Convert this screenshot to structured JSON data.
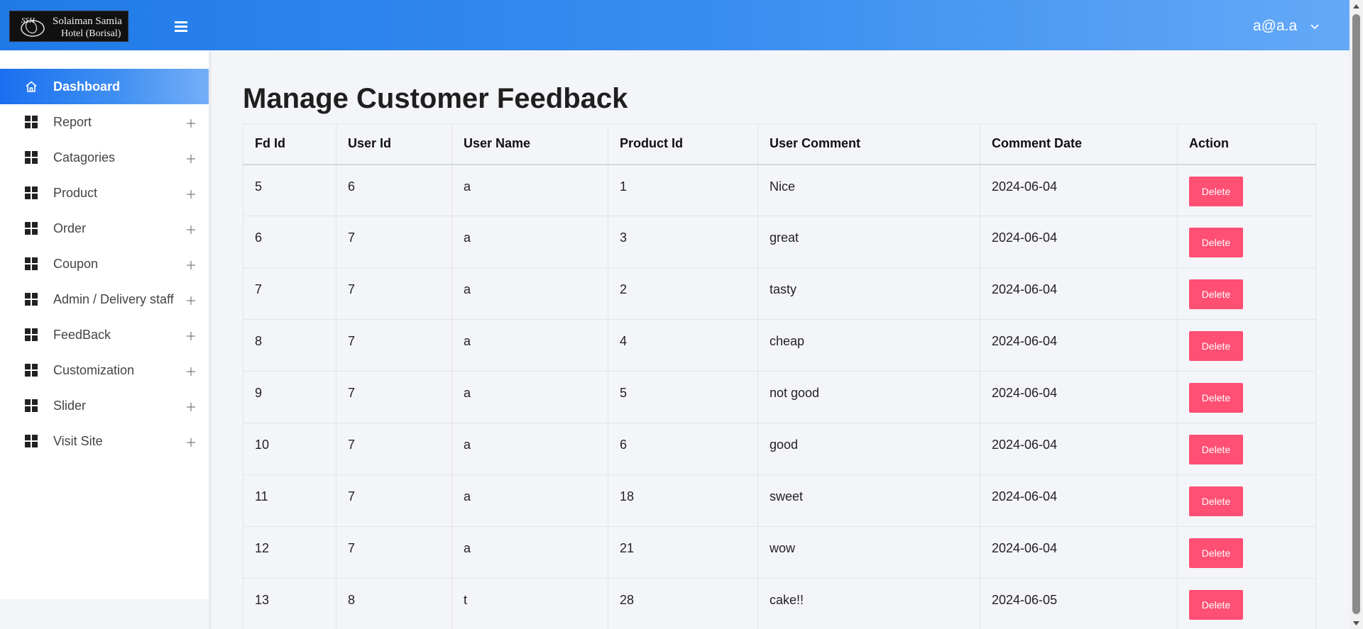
{
  "header": {
    "logo_line1": "Solaiman Samia",
    "logo_line2": "Hotel (Borisal)",
    "logo_mark": "SSH",
    "user_email": "a@a.a"
  },
  "sidebar": {
    "items": [
      {
        "label": "Dashboard",
        "active": true
      },
      {
        "label": "Report"
      },
      {
        "label": "Catagories"
      },
      {
        "label": "Product"
      },
      {
        "label": "Order"
      },
      {
        "label": "Coupon"
      },
      {
        "label": "Admin / Delivery staff"
      },
      {
        "label": "FeedBack"
      },
      {
        "label": "Customization"
      },
      {
        "label": "Slider"
      },
      {
        "label": "Visit Site"
      }
    ]
  },
  "main": {
    "title": "Manage Customer Feedback",
    "columns": [
      "Fd Id",
      "User Id",
      "User Name",
      "Product Id",
      "User Comment",
      "Comment Date",
      "Action"
    ],
    "delete_label": "Delete",
    "rows": [
      {
        "fd_id": "5",
        "user_id": "6",
        "user_name": "a",
        "product_id": "1",
        "comment": "Nice",
        "date": "2024-06-04"
      },
      {
        "fd_id": "6",
        "user_id": "7",
        "user_name": "a",
        "product_id": "3",
        "comment": "great",
        "date": "2024-06-04"
      },
      {
        "fd_id": "7",
        "user_id": "7",
        "user_name": "a",
        "product_id": "2",
        "comment": "tasty",
        "date": "2024-06-04"
      },
      {
        "fd_id": "8",
        "user_id": "7",
        "user_name": "a",
        "product_id": "4",
        "comment": "cheap",
        "date": "2024-06-04"
      },
      {
        "fd_id": "9",
        "user_id": "7",
        "user_name": "a",
        "product_id": "5",
        "comment": "not good",
        "date": "2024-06-04"
      },
      {
        "fd_id": "10",
        "user_id": "7",
        "user_name": "a",
        "product_id": "6",
        "comment": "good",
        "date": "2024-06-04"
      },
      {
        "fd_id": "11",
        "user_id": "7",
        "user_name": "a",
        "product_id": "18",
        "comment": "sweet",
        "date": "2024-06-04"
      },
      {
        "fd_id": "12",
        "user_id": "7",
        "user_name": "a",
        "product_id": "21",
        "comment": "wow",
        "date": "2024-06-04"
      },
      {
        "fd_id": "13",
        "user_id": "8",
        "user_name": "t",
        "product_id": "28",
        "comment": "cake!!",
        "date": "2024-06-05"
      }
    ]
  },
  "colors": {
    "header_start": "#1f7ae8",
    "header_end": "#63a9f7",
    "delete_button": "#ff4f73",
    "page_bg": "#f4f5f9"
  },
  "icons": {
    "menu": "hamburger-icon",
    "home": "home-icon",
    "section": "grid-icon",
    "expand": "plus-icon",
    "dropdown": "chevron-down-icon"
  }
}
